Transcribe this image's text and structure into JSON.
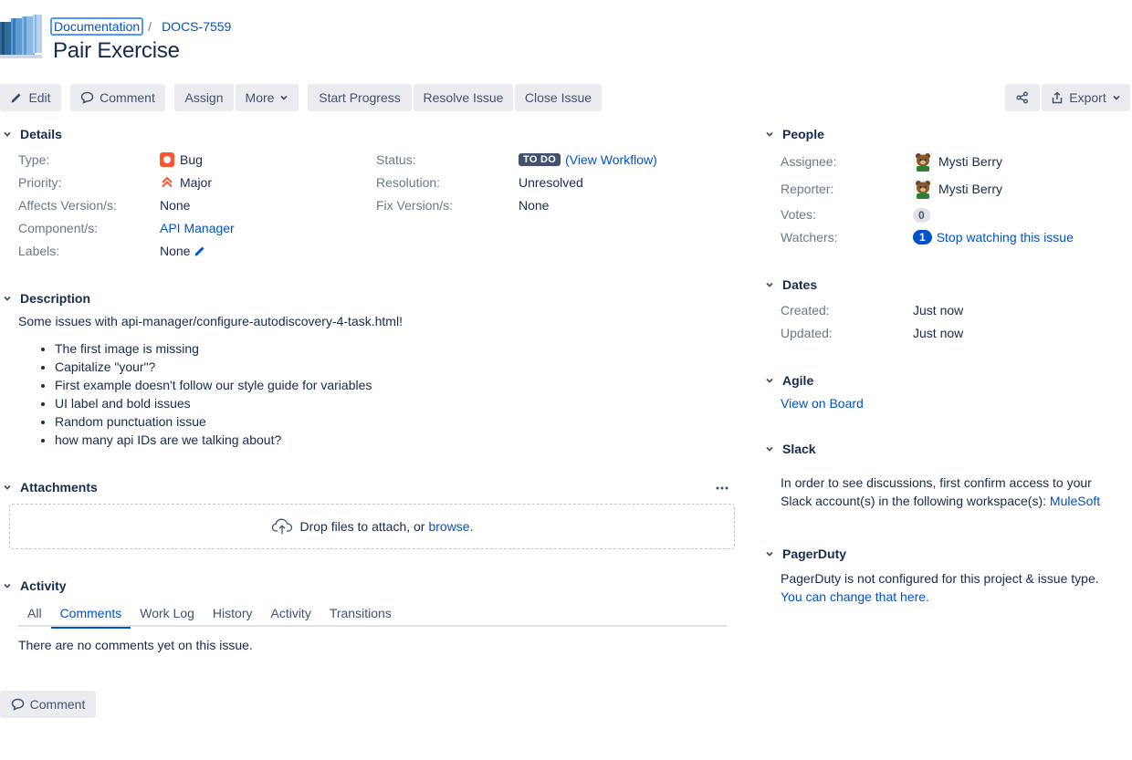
{
  "header": {
    "project": "Documentation",
    "issue_key": "DOCS-7559",
    "title": "Pair Exercise"
  },
  "toolbar": {
    "edit": "Edit",
    "comment": "Comment",
    "assign": "Assign",
    "more": "More",
    "start_progress": "Start Progress",
    "resolve_issue": "Resolve Issue",
    "close_issue": "Close Issue",
    "export": "Export"
  },
  "details": {
    "heading": "Details",
    "type_label": "Type:",
    "type_value": "Bug",
    "priority_label": "Priority:",
    "priority_value": "Major",
    "affects_label": "Affects Version/s:",
    "affects_value": "None",
    "component_label": "Component/s:",
    "component_value": "API Manager",
    "labels_label": "Labels:",
    "labels_value": "None",
    "status_label": "Status:",
    "status_value": "TO DO",
    "view_workflow": "(View Workflow)",
    "resolution_label": "Resolution:",
    "resolution_value": "Unresolved",
    "fix_label": "Fix Version/s:",
    "fix_value": "None"
  },
  "description": {
    "heading": "Description",
    "intro": "Some issues with api-manager/configure-autodiscovery-4-task.html!",
    "items": [
      "The first image is missing",
      "Capitalize \"your\"?",
      "First example doesn't follow our style guide for variables",
      "UI label and bold issues",
      "Random punctuation issue",
      "how many api IDs are we talking about?"
    ]
  },
  "attachments": {
    "heading": "Attachments",
    "drop_text": "Drop files to attach, or",
    "browse": "browse."
  },
  "activity": {
    "heading": "Activity",
    "tabs": [
      "All",
      "Comments",
      "Work Log",
      "History",
      "Activity",
      "Transitions"
    ],
    "active_tab": "Comments",
    "empty": "There are no comments yet on this issue.",
    "comment_button": "Comment"
  },
  "people": {
    "heading": "People",
    "assignee_label": "Assignee:",
    "assignee": "Mysti Berry",
    "reporter_label": "Reporter:",
    "reporter": "Mysti Berry",
    "votes_label": "Votes:",
    "votes": "0",
    "watchers_label": "Watchers:",
    "watchers": "1",
    "stop_watching": "Stop watching this issue"
  },
  "dates": {
    "heading": "Dates",
    "created_label": "Created:",
    "created": "Just now",
    "updated_label": "Updated:",
    "updated": "Just now"
  },
  "agile": {
    "heading": "Agile",
    "view_on_board": "View on Board"
  },
  "slack": {
    "heading": "Slack",
    "text_line1": "In order to see discussions, first confirm access to your",
    "text_line2": "Slack account(s) in the following workspace(s):",
    "workspace": "MuleSoft"
  },
  "pagerduty": {
    "heading": "PagerDuty",
    "text": "PagerDuty is not configured for this project & issue type.",
    "link": "You can change that here."
  },
  "colors": {
    "link": "#0052cc",
    "text": "#172b4d",
    "muted": "#6b778c",
    "button_bg": "#ebecf0",
    "bug": "#ff5630",
    "priority": "#ff5630",
    "lozenge": "#42526e"
  }
}
